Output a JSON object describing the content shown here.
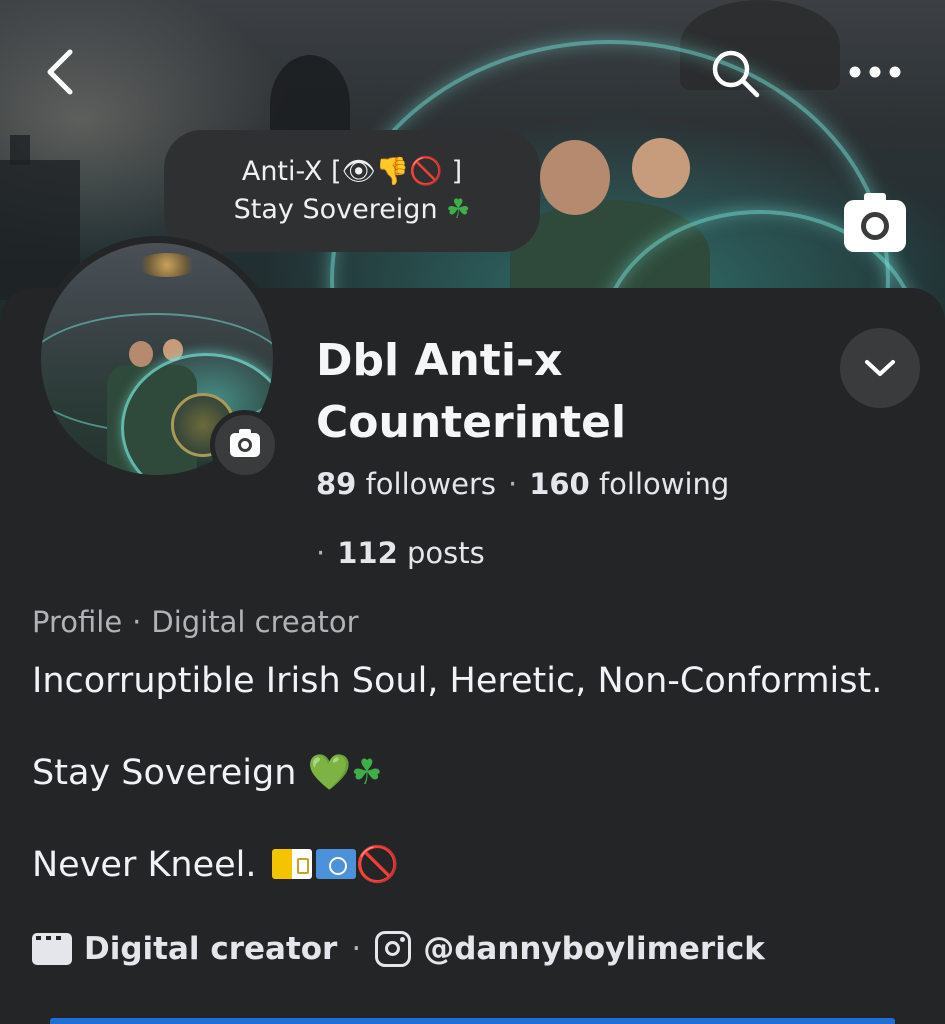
{
  "header": {
    "back_icon": "chevron-left-icon",
    "search_icon": "search-icon",
    "more_icon": "more-dots-icon",
    "cover_camera_icon": "camera-icon"
  },
  "note": {
    "line1_text": "Anti-X [👁👎🚫  ]",
    "line2_text": "Stay Sovereign",
    "line2_emoji": "☘"
  },
  "profile": {
    "name_line1": "Dbl Anti-x",
    "name_line2": "Counterintel",
    "followers_count": "89",
    "followers_label": "followers",
    "following_count": "160",
    "following_label": "following",
    "posts_count": "112",
    "posts_label": "posts",
    "separator": "·",
    "category_prefix": "Profile",
    "category": "Digital creator"
  },
  "bio": {
    "line1": "Incorruptible Irish Soul, Heretic, Non-Conformist.",
    "line2_text": "Stay Sovereign",
    "line2_heart": "💚",
    "line2_shamrock": "☘",
    "line3_text": "Never Kneel.",
    "line3_no_sign": "🚫"
  },
  "links": {
    "creator_label": "Digital creator",
    "instagram_handle": "@dannyboylimerick"
  },
  "colors": {
    "background": "#242526",
    "accent": "#1f6fd6",
    "muted_text": "#b0b3b8",
    "primary_text": "#e4e6eb"
  }
}
